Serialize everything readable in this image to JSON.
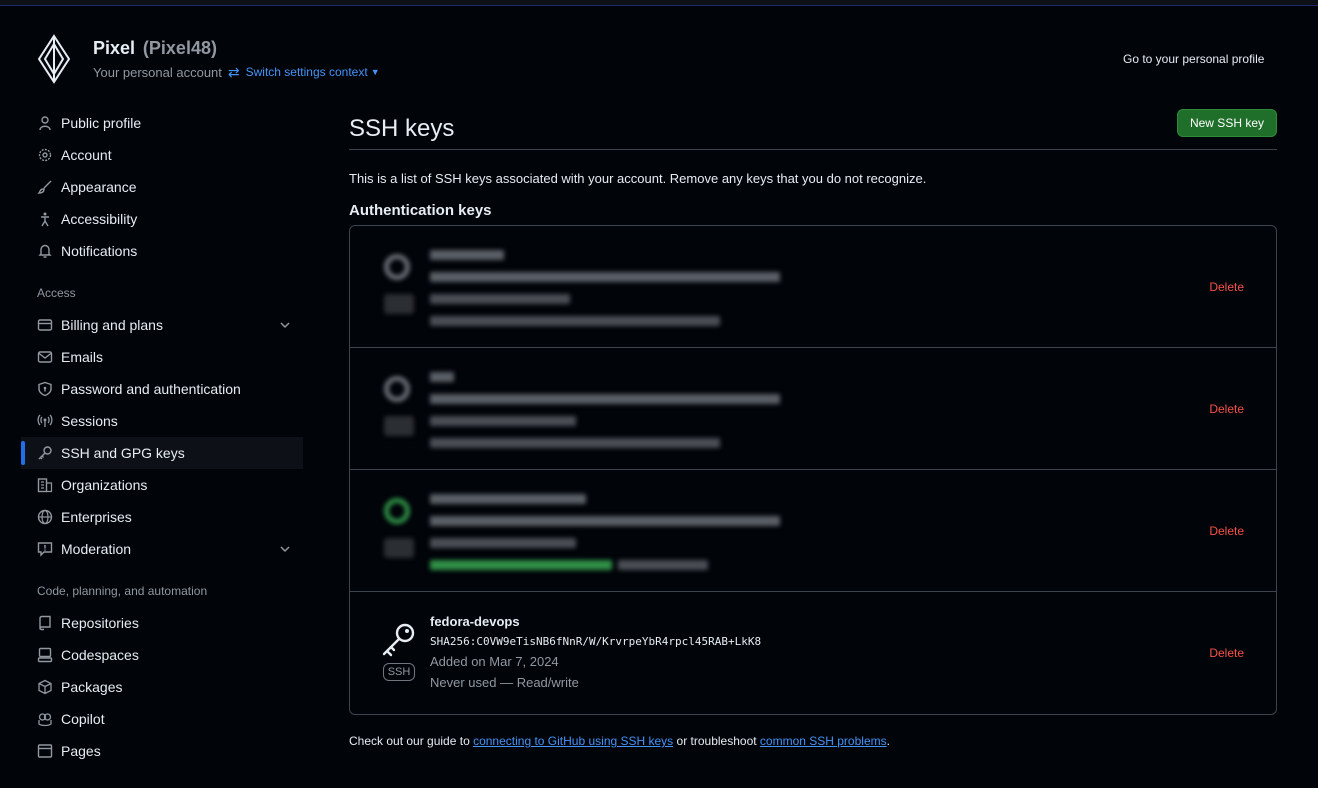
{
  "header": {
    "name": "Pixel",
    "login": "(Pixel48)",
    "subtitle": "Your personal account",
    "switch_context": "Switch settings context",
    "profile_link": "Go to your personal profile"
  },
  "sidebar": {
    "items_top": [
      {
        "label": "Public profile",
        "icon": "person-icon"
      },
      {
        "label": "Account",
        "icon": "gear-icon"
      },
      {
        "label": "Appearance",
        "icon": "paintbrush-icon"
      },
      {
        "label": "Accessibility",
        "icon": "accessibility-icon"
      },
      {
        "label": "Notifications",
        "icon": "bell-icon"
      }
    ],
    "section_access": "Access",
    "items_access": [
      {
        "label": "Billing and plans",
        "icon": "credit-card-icon"
      },
      {
        "label": "Emails",
        "icon": "mail-icon"
      },
      {
        "label": "Password and authentication",
        "icon": "shield-lock-icon"
      },
      {
        "label": "Sessions",
        "icon": "broadcast-icon"
      },
      {
        "label": "SSH and GPG keys",
        "icon": "key-icon"
      },
      {
        "label": "Organizations",
        "icon": "organization-icon"
      },
      {
        "label": "Enterprises",
        "icon": "globe-icon"
      },
      {
        "label": "Moderation",
        "icon": "report-icon"
      }
    ],
    "section_code": "Code, planning, and automation",
    "items_code": [
      {
        "label": "Repositories",
        "icon": "repo-icon"
      },
      {
        "label": "Codespaces",
        "icon": "codespaces-icon"
      },
      {
        "label": "Packages",
        "icon": "package-icon"
      },
      {
        "label": "Copilot",
        "icon": "copilot-icon"
      },
      {
        "label": "Pages",
        "icon": "browser-icon"
      }
    ]
  },
  "main": {
    "title": "SSH keys",
    "new_button": "New SSH key",
    "intro": "This is a list of SSH keys associated with your account. Remove any keys that you do not recognize.",
    "section_title": "Authentication keys",
    "delete_label": "Delete",
    "visible_key": {
      "title": "fedora-devops",
      "fingerprint": "SHA256:C0VW9eTisNB6fNnR/W/KrvrpeYbR4rpcl45RAB+LkK8",
      "added": "Added on Mar 7, 2024",
      "usage": "Never used — Read/write",
      "badge": "SSH"
    },
    "guide_prefix": "Check out our guide to ",
    "guide_link1": "connecting to GitHub using SSH keys",
    "guide_mid": " or troubleshoot ",
    "guide_link2": "common SSH problems",
    "guide_suffix": "."
  },
  "colors": {
    "accent": "#4493f8",
    "danger": "#f85149",
    "primary_button": "#1f6f2a",
    "active_indicator": "#1f6feb"
  }
}
